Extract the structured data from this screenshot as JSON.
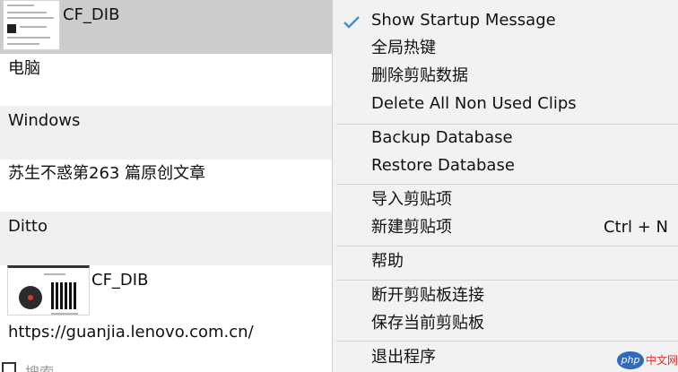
{
  "clip_list": {
    "items": [
      {
        "type": "image",
        "label": "CF_DIB"
      },
      {
        "type": "text",
        "text": "电脑"
      },
      {
        "type": "text",
        "text": "Windows"
      },
      {
        "type": "text",
        "text": "苏生不惑第263 篇原创文章"
      },
      {
        "type": "text",
        "text": "Ditto"
      },
      {
        "type": "image",
        "label": "CF_DIB"
      },
      {
        "type": "text",
        "text": "https://guanjia.lenovo.com.cn/"
      }
    ],
    "bottom_text": "搜索"
  },
  "context_menu": {
    "items": [
      {
        "label": "Show Startup Message",
        "checked": true
      },
      {
        "label": "全局热键"
      },
      {
        "label": "删除剪贴数据"
      },
      {
        "label": "Delete All Non Used Clips"
      },
      {
        "label": "Backup Database"
      },
      {
        "label": "Restore Database"
      },
      {
        "label": "导入剪贴项"
      },
      {
        "label": "新建剪贴项",
        "shortcut": "Ctrl + N"
      },
      {
        "label": "帮助"
      },
      {
        "label": "断开剪贴板连接"
      },
      {
        "label": "保存当前剪贴板"
      },
      {
        "label": "退出程序"
      }
    ]
  },
  "watermark": {
    "badge": "php",
    "text": "中文网"
  },
  "colors": {
    "check": "#3d8fe0",
    "selected_row": "#cccccc",
    "menu_bg": "#f2f2f2"
  }
}
